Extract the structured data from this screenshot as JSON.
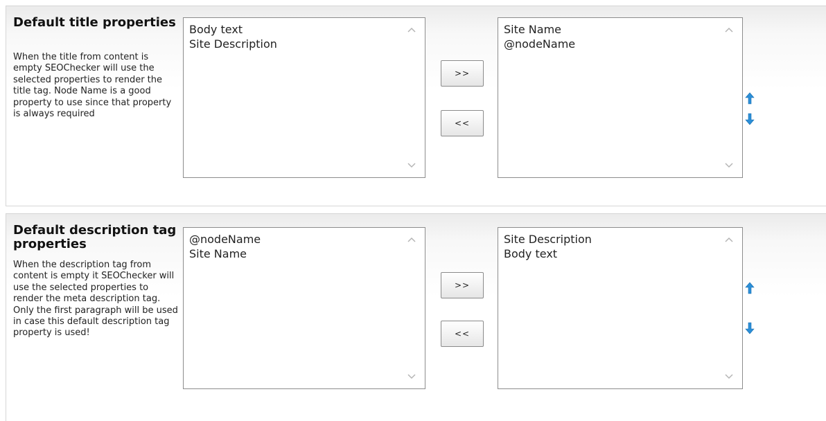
{
  "sections": [
    {
      "title": "Default title properties",
      "description": "When the title from content is empty SEOChecker will use the selected properties to render the title tag. Node Name is a good property to use since that property is always required",
      "available": [
        "Body text",
        "Site Description"
      ],
      "selected": [
        "Site Name",
        "@nodeName"
      ],
      "add_label": ">>",
      "remove_label": "<<"
    },
    {
      "title": "Default description tag properties",
      "description": "When the description tag from content is empty it SEOChecker will use the selected properties to render the meta description tag. Only the first paragraph will be used in case this default description tag property is used!",
      "available": [
        "@nodeName",
        "Site Name"
      ],
      "selected": [
        "Site Description",
        "Body text"
      ],
      "add_label": ">>",
      "remove_label": "<<"
    }
  ],
  "colors": {
    "arrow_blue": "#2b8fd8",
    "scroll_gray": "#b5b5b5"
  },
  "icons": {
    "move_up": "arrow-up-icon",
    "move_down": "arrow-down-icon"
  }
}
